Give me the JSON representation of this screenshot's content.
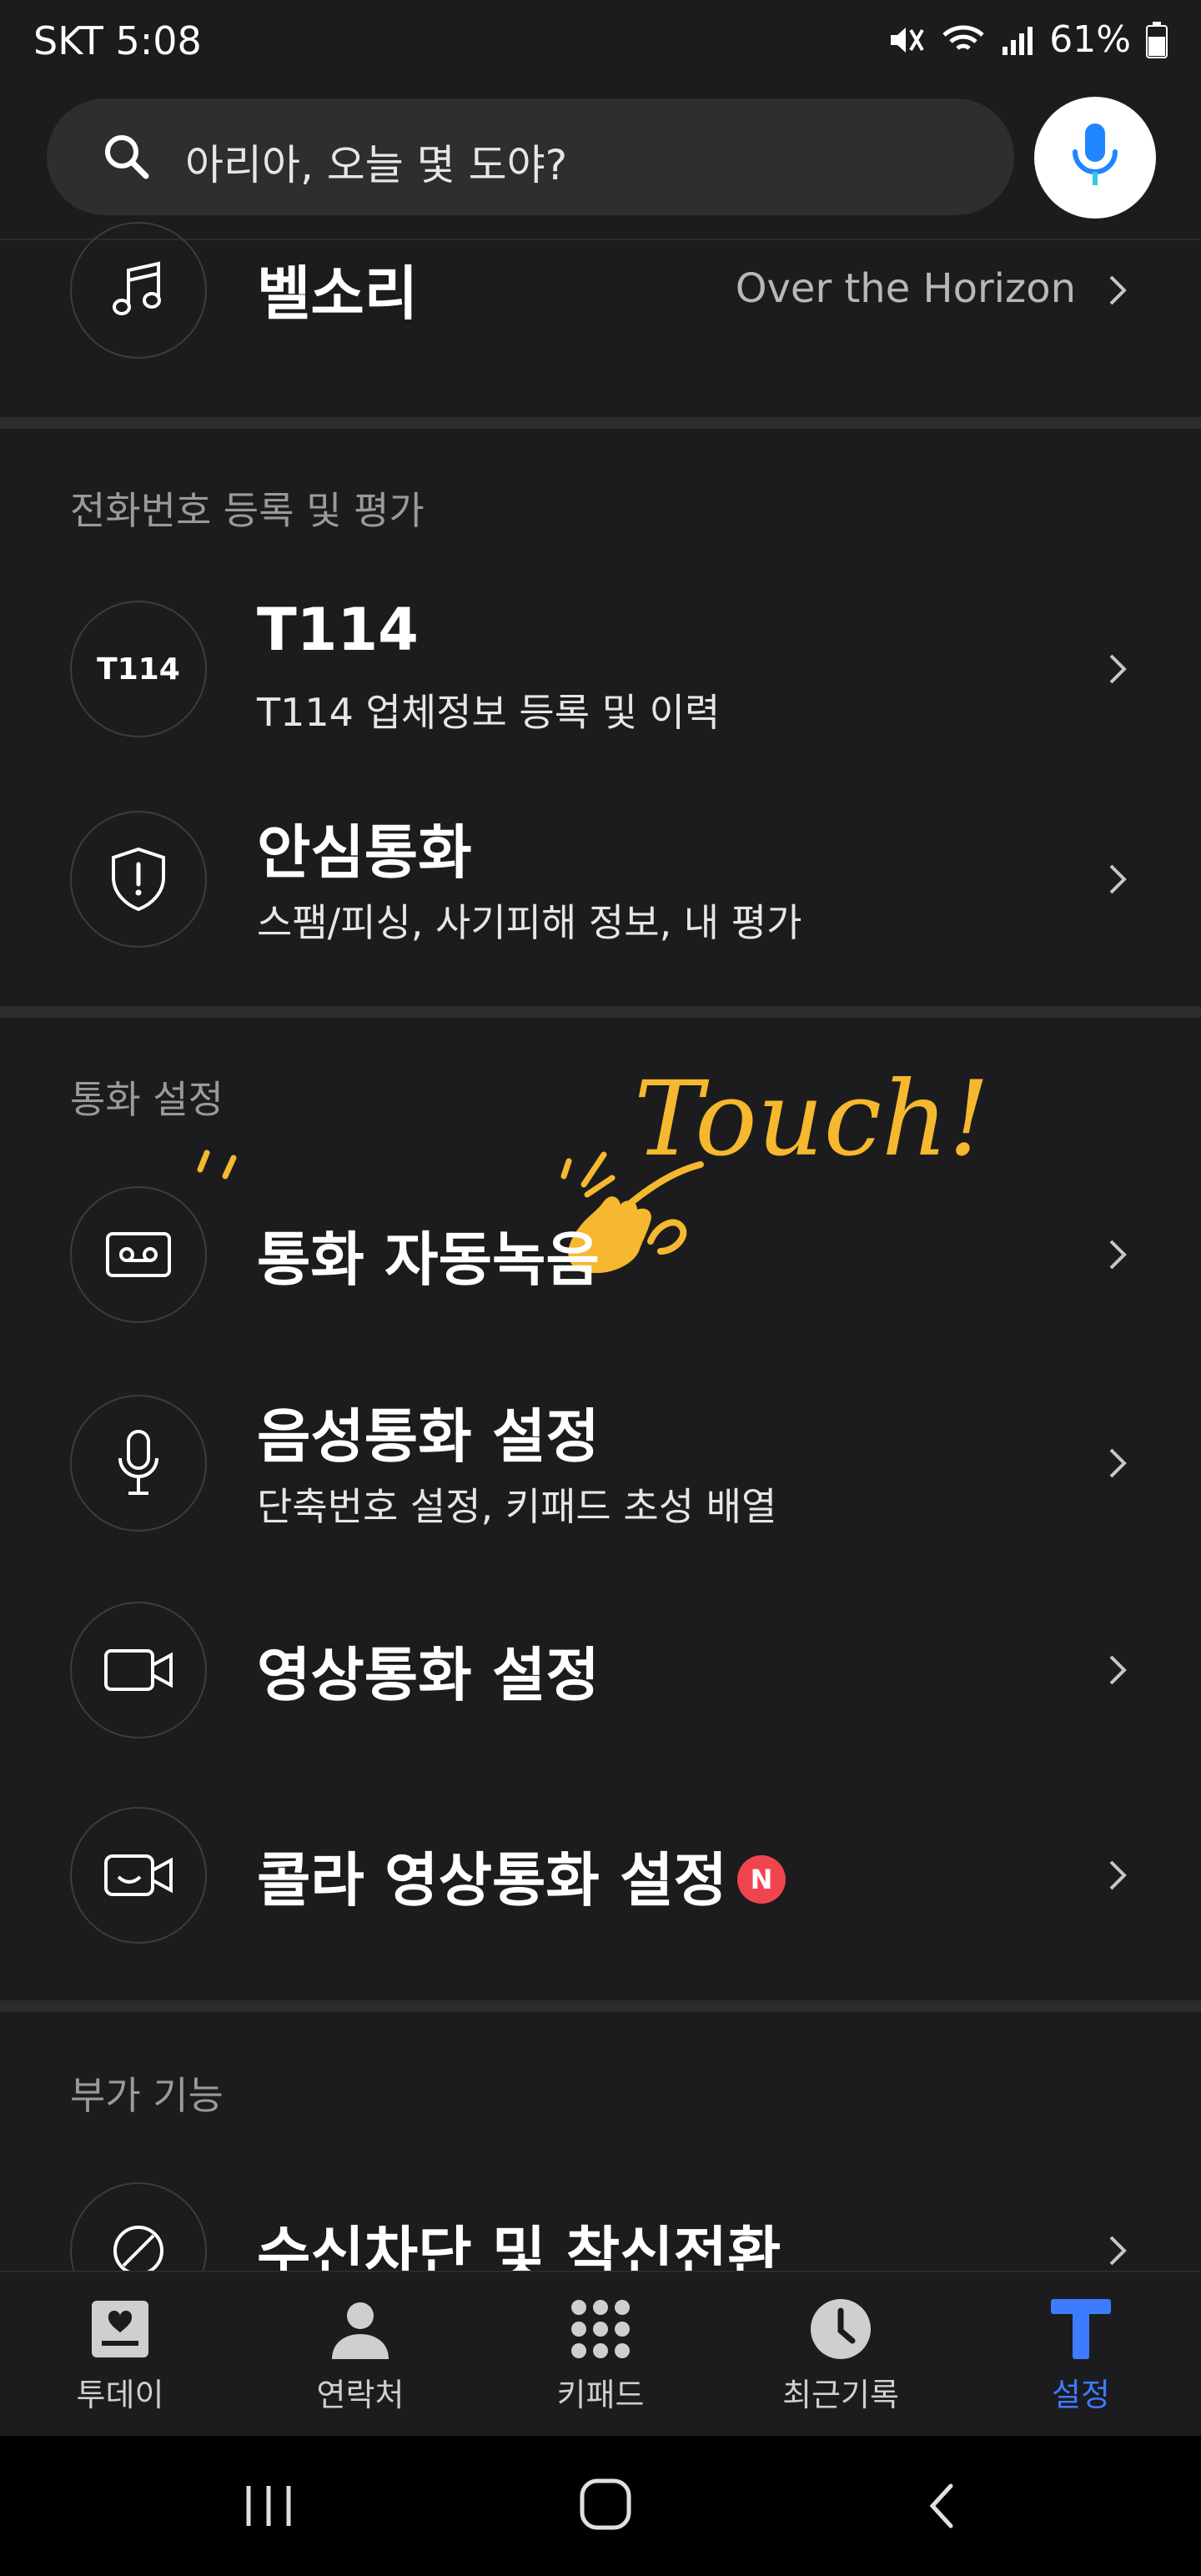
{
  "status_bar": {
    "carrier_time": "SKT 5:08",
    "battery": "61%"
  },
  "search": {
    "placeholder": "아리아, 오늘 몇 도야?"
  },
  "ringtone_row": {
    "title": "벨소리",
    "value": "Over the Horizon"
  },
  "section_phone_registration": {
    "title": "전화번호 등록 및 평가",
    "items": [
      {
        "title": "T114",
        "icon_text": "T114",
        "subtitle": "T114 업체정보 등록 및 이력"
      },
      {
        "title": "안심통화",
        "subtitle": "스팸/피싱, 사기피해 정보, 내 평가"
      }
    ]
  },
  "section_call_settings": {
    "title": "통화 설정",
    "items": [
      {
        "title": "통화 자동녹음"
      },
      {
        "title": "음성통화 설정",
        "subtitle": "단축번호 설정, 키패드 초성 배열"
      },
      {
        "title": "영상통화 설정"
      },
      {
        "title": "콜라 영상통화 설정",
        "badge": "N"
      }
    ]
  },
  "section_extra": {
    "title": "부가 기능",
    "items": [
      {
        "title": "수신차단 및 착신전환"
      }
    ]
  },
  "annotation": {
    "text": "Touch!"
  },
  "bottom_nav": {
    "items": [
      {
        "label": "투데이",
        "icon": "today-icon"
      },
      {
        "label": "연락처",
        "icon": "contacts-icon"
      },
      {
        "label": "키패드",
        "icon": "keypad-icon"
      },
      {
        "label": "최근기록",
        "icon": "clock-icon"
      },
      {
        "label": "설정",
        "icon": "settings-t-icon",
        "active": true
      }
    ]
  },
  "colors": {
    "background": "#1c1c1e",
    "accent": "#3d7bff",
    "badge": "#f0454e",
    "annotation": "#f5b82e"
  }
}
